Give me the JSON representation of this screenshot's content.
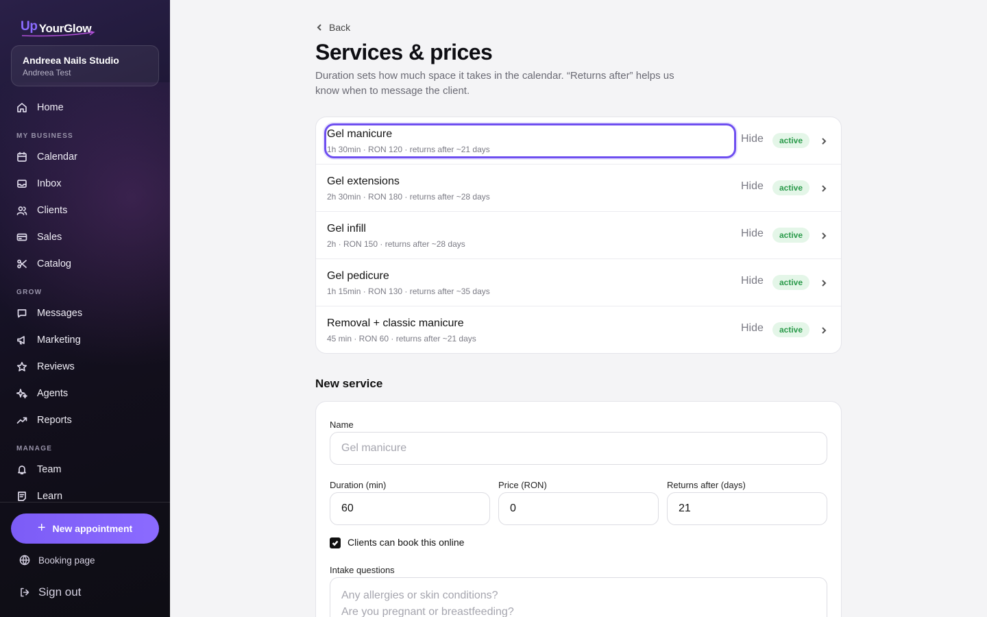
{
  "sidebar": {
    "logo": {
      "up": "Up",
      "name": "YourGlow"
    },
    "studio": {
      "name": "Andreea Nails Studio",
      "owner": "Andreea Test"
    },
    "home": "Home",
    "sections": {
      "my_business": "MY BUSINESS",
      "grow": "GROW",
      "manage": "MANAGE"
    },
    "items": {
      "calendar": "Calendar",
      "inbox": "Inbox",
      "clients": "Clients",
      "sales": "Sales",
      "catalog": "Catalog",
      "messages": "Messages",
      "marketing": "Marketing",
      "reviews": "Reviews",
      "agents": "Agents",
      "reports": "Reports",
      "team": "Team",
      "learn": "Learn"
    },
    "new_appointment": "New appointment",
    "booking_page": "Booking page",
    "sign_out": "Sign out"
  },
  "header": {
    "back": "Back",
    "title": "Services & prices",
    "description": "Duration sets how much space it takes in the calendar. “Returns after” helps us know when to message the client."
  },
  "services": [
    {
      "name": "Gel manicure",
      "meta": "1h 30min · RON 120 · returns after ~21 days",
      "hide": "Hide",
      "status": "active"
    },
    {
      "name": "Gel extensions",
      "meta": "2h 30min · RON 180 · returns after ~28 days",
      "hide": "Hide",
      "status": "active"
    },
    {
      "name": "Gel infill",
      "meta": "2h · RON 150 · returns after ~28 days",
      "hide": "Hide",
      "status": "active"
    },
    {
      "name": "Gel pedicure",
      "meta": "1h 15min · RON 130 · returns after ~35 days",
      "hide": "Hide",
      "status": "active"
    },
    {
      "name": "Removal + classic manicure",
      "meta": "45 min · RON 60 · returns after ~21 days",
      "hide": "Hide",
      "status": "active"
    }
  ],
  "new_service": {
    "title": "New service",
    "name_label": "Name",
    "name_placeholder": "Gel manicure",
    "duration_label": "Duration (min)",
    "duration_value": "60",
    "price_label": "Price (RON)",
    "price_value": "0",
    "returns_label": "Returns after (days)",
    "returns_value": "21",
    "online_label": "Clients can book this online",
    "online_checked": true,
    "intake_label": "Intake questions",
    "intake_placeholder_line1": "Any allergies or skin conditions?",
    "intake_placeholder_line2": "Are you pregnant or breastfeeding?"
  },
  "colors": {
    "accent": "#7c5cf6",
    "active_bg": "#e4f6e8",
    "active_text": "#2a9a4a"
  }
}
